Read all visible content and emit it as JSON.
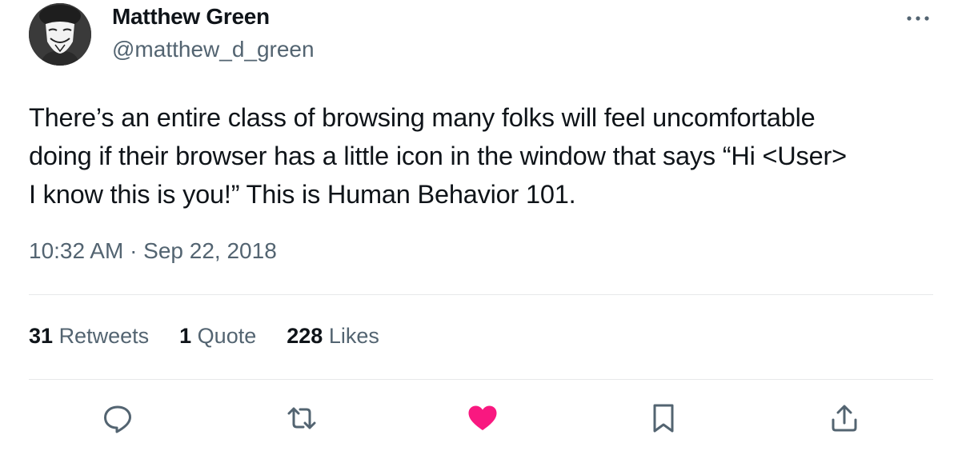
{
  "author": {
    "name": "Matthew Green",
    "handle": "@matthew_d_green",
    "avatar_icon": "avatar-mask-photo"
  },
  "tweet": {
    "lines": [
      "There’s an entire class of browsing many folks will feel uncomfortable",
      "doing if their browser has a little icon in the window that says “Hi <User>",
      "I know this is you!” This is Human Behavior 101."
    ],
    "timestamp": "10:32 AM · Sep 22, 2018"
  },
  "stats": {
    "retweets_count": "31",
    "retweets_label": "Retweets",
    "quotes_count": "1",
    "quotes_label": "Quote",
    "likes_count": "228",
    "likes_label": "Likes"
  },
  "actions": {
    "reply_icon": "reply-icon",
    "retweet_icon": "retweet-icon",
    "like_icon": "heart-icon",
    "bookmark_icon": "bookmark-icon",
    "share_icon": "share-icon"
  },
  "colors": {
    "text_primary": "#0f1419",
    "text_secondary": "#536471",
    "divider": "#e7e9ea",
    "like_active": "#f91880"
  }
}
